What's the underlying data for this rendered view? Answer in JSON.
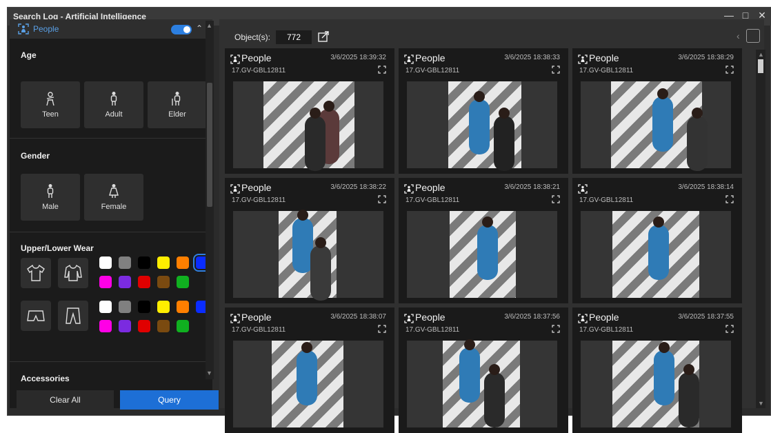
{
  "window": {
    "title": "Search Log - Artificial Intelligence"
  },
  "filter": {
    "header_label": "People",
    "enabled": true,
    "age": {
      "title": "Age",
      "options": [
        "Teen",
        "Adult",
        "Elder"
      ]
    },
    "gender": {
      "title": "Gender",
      "options": [
        "Male",
        "Female"
      ]
    },
    "wear": {
      "title": "Upper/Lower Wear",
      "upper_colors": [
        "#ffffff",
        "#808080",
        "#000000",
        "#ffee00",
        "#ff7f00",
        "#0a2cff",
        "#ff00e6",
        "#7b2be0",
        "#e00000",
        "#7a4a10",
        "#10b020"
      ],
      "lower_colors": [
        "#ffffff",
        "#808080",
        "#000000",
        "#ffee00",
        "#ff7f00",
        "#0a2cff",
        "#ff00e6",
        "#7b2be0",
        "#e00000",
        "#7a4a10",
        "#10b020"
      ],
      "selected_upper_color": "#0a2cff"
    },
    "accessories": {
      "title": "Accessories"
    },
    "clear_label": "Clear All",
    "query_label": "Query"
  },
  "results": {
    "objects_label": "Object(s):",
    "count": "772",
    "items": [
      {
        "label": "People",
        "date": "3/6/2025 18:39:32",
        "camera": "17.GV-GBL12811"
      },
      {
        "label": "People",
        "date": "3/6/2025 18:38:33",
        "camera": "17.GV-GBL12811"
      },
      {
        "label": "People",
        "date": "3/6/2025 18:38:29",
        "camera": "17.GV-GBL12811"
      },
      {
        "label": "People",
        "date": "3/6/2025 18:38:22",
        "camera": "17.GV-GBL12811"
      },
      {
        "label": "People",
        "date": "3/6/2025 18:38:21",
        "camera": "17.GV-GBL12811"
      },
      {
        "label": "",
        "date": "3/6/2025 18:38:14",
        "camera": "17.GV-GBL12811"
      },
      {
        "label": "People",
        "date": "3/6/2025 18:38:07",
        "camera": "17.GV-GBL12811"
      },
      {
        "label": "People",
        "date": "3/6/2025 18:37:56",
        "camera": "17.GV-GBL12811"
      },
      {
        "label": "People",
        "date": "3/6/2025 18:37:55",
        "camera": "17.GV-GBL12811"
      }
    ]
  },
  "colors": {
    "accent": "#1d6fd6",
    "panel": "#1b1b1b",
    "card": "#1a1a1a"
  }
}
